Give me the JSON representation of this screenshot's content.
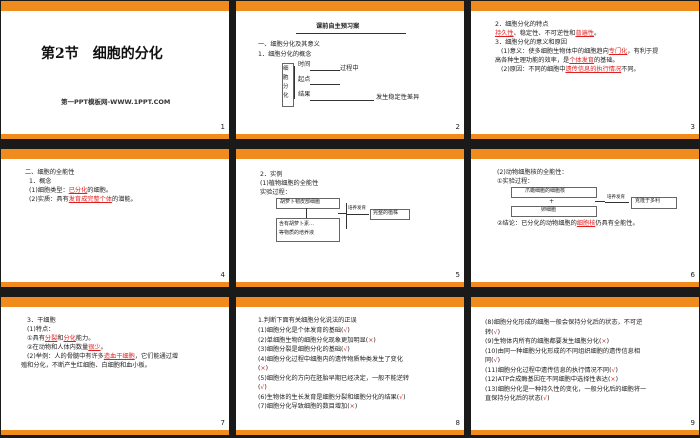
{
  "slides": [
    {
      "num": "1",
      "title": "第2节　细胞的分化",
      "subtitle": "第一PPT模板网-WWW.1PPT.COM"
    },
    {
      "num": "2",
      "header": "课前自主预习案",
      "h1": "一、细胞分化及其意义",
      "h2": "1．细胞分化的概念",
      "vlabel": "细胞分化",
      "r1": "时间",
      "r1b": "过程中",
      "r2": "起点",
      "r3": "结果",
      "r3b": "发生稳定性差异"
    },
    {
      "num": "3",
      "l1": "2．细胞分化的特点",
      "l2a": "持久性",
      "l2b": "、稳定性、不可逆性和",
      "l2c": "普遍性",
      "l2d": "。",
      "l3": "3．细胞分化的意义和原因",
      "l4a": "(1)意义：使多细胞生物体中的细胞趋向",
      "l4b": "专门化",
      "l4c": "，有利于提",
      "l5a": "高各种生理功能的效率，是",
      "l5b": "个体发育",
      "l5c": "的基础。",
      "l6a": "(2)原因：不同的细胞中",
      "l6b": "遗传信息的执行情况",
      "l6c": "不同。"
    },
    {
      "num": "4",
      "l1": "二、细胞的全能性",
      "l2": "1．概念",
      "l3a": "(1)细胞类型：",
      "l3b": "已分化",
      "l3c": "的细胞。",
      "l4a": "(2)实质：具有",
      "l4b": "发育成完整个体",
      "l4c": "的潜能。"
    },
    {
      "num": "5",
      "l1": "2．实例",
      "l2": "(1)植物细胞的全能性",
      "l3": "实验过程：",
      "b1": "胡萝卜韧皮部细胞",
      "b2": "含有胡萝卜素…",
      "b3": "等物质的培养液",
      "arrow1": "培养发育",
      "b4": "完整的植株"
    },
    {
      "num": "6",
      "l1": "(2)动物细胞核的全能性：",
      "l2": "①实验过程：",
      "b1": "爪蟾细胞的细胞核",
      "b2": "卵细胞",
      "arrow1": "培养发育",
      "b3": "克隆于多利",
      "l3a": "②结论：已分化的动物细胞的",
      "l3b": "细胞核",
      "l3c": "仍具有全能性。"
    },
    {
      "num": "7",
      "l1": "3．干细胞",
      "l2": "(1)特点：",
      "l3a": "①具有",
      "l3b": "分裂",
      "l3c": "和",
      "l3d": "分化",
      "l3e": "能力。",
      "l4a": "②在动物和人体内数量",
      "l4b": "很少",
      "l4c": "。",
      "l5a": "(2)举例：人的骨髓中有许多",
      "l5b": "造血干细胞",
      "l5c": "，它们能通过增",
      "l6": "殖和分化，不断产生红细胞、白细胞和血小板。"
    },
    {
      "num": "8",
      "l0": "1.判断下面有关细胞分化说法的正误",
      "items": [
        {
          "a": "(1)细胞分化是个体发育的基础(",
          "m": "√",
          "b": ")"
        },
        {
          "a": "(2)单细胞生物的细胞分化现象更加明显(",
          "m": "×",
          "b": ")"
        },
        {
          "a": "(3)细胞分裂是细胞分化的基础(",
          "m": "√",
          "b": ")"
        },
        {
          "a": "(4)细胞分化过程中细胞内的遗传物质种类发生了变化",
          "m": "",
          "b": ""
        },
        {
          "a": "(",
          "m": "×",
          "b": ")"
        },
        {
          "a": "(5)细胞分化的方向在胚胎早期已经决定，一般不能逆转",
          "m": "",
          "b": ""
        },
        {
          "a": "(",
          "m": "√",
          "b": ")"
        },
        {
          "a": "(6)生物体的生长发育是细胞分裂和细胞分化的结果(",
          "m": "√",
          "b": ")"
        },
        {
          "a": "(7)细胞分化导致细胞的数目增加(",
          "m": "×",
          "b": ")"
        }
      ]
    },
    {
      "num": "9",
      "items": [
        {
          "a": "(8)细胞分化形成的细胞一般会保持分化后的状态，不可逆",
          "m": "",
          "b": ""
        },
        {
          "a": "转(",
          "m": "√",
          "b": ")"
        },
        {
          "a": "(9)生物体内所有的细胞都要发生细胞分化(",
          "m": "×",
          "b": ")"
        },
        {
          "a": "(10)由同一种细胞分化形成的不同组织细胞的遗传信息相",
          "m": "",
          "b": ""
        },
        {
          "a": "同(",
          "m": "√",
          "b": ")"
        },
        {
          "a": "(11)细胞分化过程中遗传信息的执行情况不同(",
          "m": "√",
          "b": ")"
        },
        {
          "a": "(12)ATP合成酶基因在不同细胞中选择性表达(",
          "m": "×",
          "b": ")"
        },
        {
          "a": "(13)细胞分化是一种持久性的变化，一般分化后的细胞将一",
          "m": "",
          "b": ""
        },
        {
          "a": "直保持分化后的状态(",
          "m": "√",
          "b": ")"
        }
      ]
    }
  ]
}
